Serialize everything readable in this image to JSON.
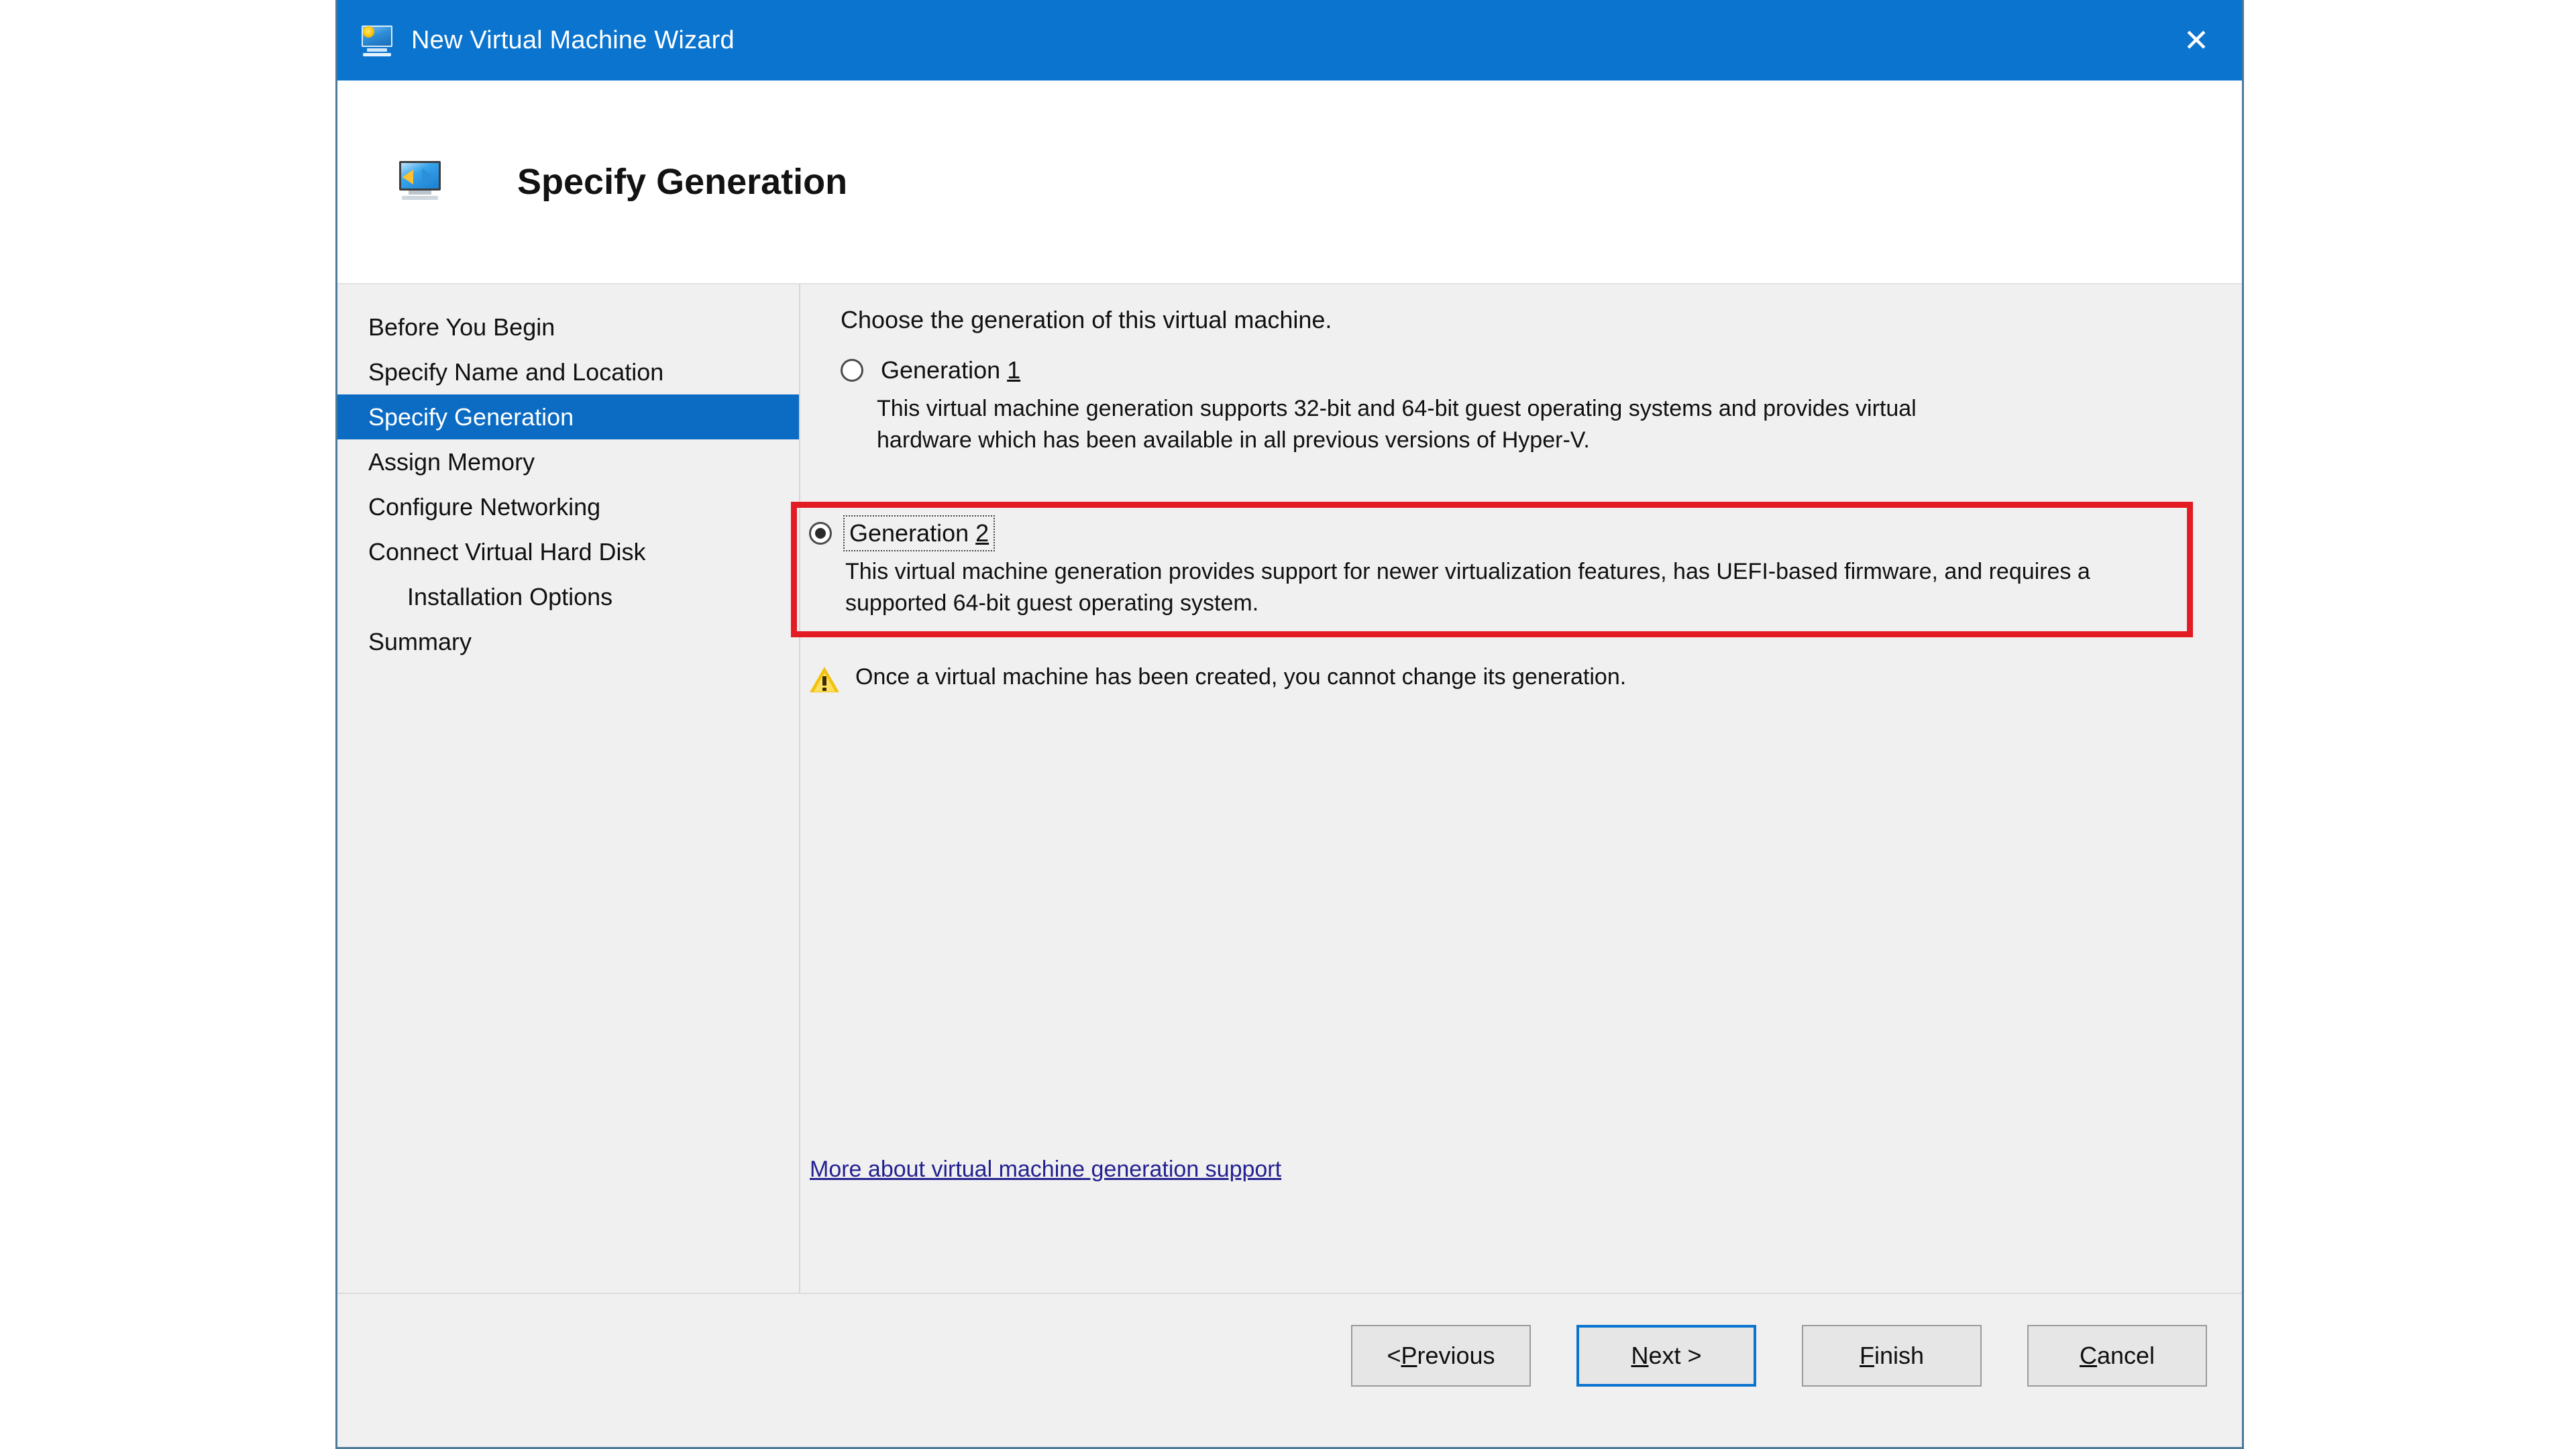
{
  "window": {
    "title": "New Virtual Machine Wizard",
    "title_icon": "virtual-machine-icon",
    "close_label": "✕",
    "accent_titlebar": "#0b74cf"
  },
  "header": {
    "title": "Specify Generation",
    "icon": "specify-generation-icon"
  },
  "sidebar": {
    "items": [
      {
        "label": "Before You Begin",
        "active": false,
        "indented": false
      },
      {
        "label": "Specify Name and Location",
        "active": false,
        "indented": false
      },
      {
        "label": "Specify Generation",
        "active": true,
        "indented": false
      },
      {
        "label": "Assign Memory",
        "active": false,
        "indented": false
      },
      {
        "label": "Configure Networking",
        "active": false,
        "indented": false
      },
      {
        "label": "Connect Virtual Hard Disk",
        "active": false,
        "indented": false
      },
      {
        "label": "Installation Options",
        "active": false,
        "indented": true
      },
      {
        "label": "Summary",
        "active": false,
        "indented": false
      }
    ],
    "highlight_color": "#0c6cc4"
  },
  "content": {
    "intro": "Choose the generation of this virtual machine.",
    "generation1": {
      "label_prefix": "Generation ",
      "label_accel": "1",
      "selected": false,
      "description": "This virtual machine generation supports 32-bit and 64-bit guest operating systems and provides virtual hardware which has been available in all previous versions of Hyper-V."
    },
    "generation2": {
      "label_prefix": "Generation ",
      "label_accel": "2",
      "selected": true,
      "focused": true,
      "highlight_color": "#e31b23",
      "description": "This virtual machine generation provides support for newer virtualization features, has UEFI-based firmware, and requires a supported 64-bit guest operating system."
    },
    "warning": {
      "icon": "warning-triangle-icon",
      "text": "Once a virtual machine has been created, you cannot change its generation."
    },
    "more_link": "More about virtual machine generation support"
  },
  "footer": {
    "buttons": [
      {
        "name": "previous",
        "prefix": "< ",
        "accel": "P",
        "suffix": "revious",
        "default": false
      },
      {
        "name": "next",
        "prefix": "",
        "accel": "N",
        "suffix": "ext >",
        "default": true
      },
      {
        "name": "finish",
        "prefix": "",
        "accel": "F",
        "suffix": "inish",
        "default": false
      },
      {
        "name": "cancel",
        "prefix": "",
        "accel": "C",
        "suffix": "ancel",
        "default": false
      }
    ]
  }
}
